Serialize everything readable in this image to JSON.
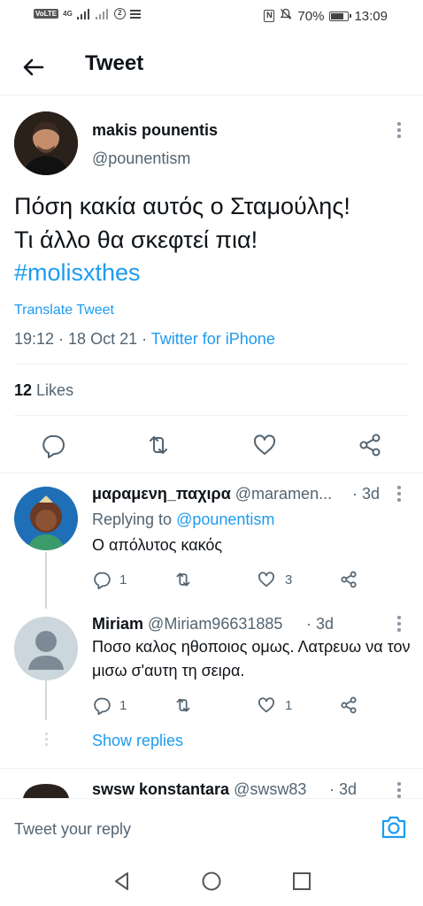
{
  "status_bar": {
    "volte": "VoLTE",
    "network": "4G",
    "battery": "70%",
    "time": "13:09"
  },
  "header": {
    "title": "Tweet"
  },
  "tweet": {
    "author_name": "makis pounentis",
    "author_handle": "@pounentism",
    "text_line1": "Πόση κακία αυτός ο Σταμούλης!",
    "text_line2": "Τι άλλο θα σκεφτεί πια!",
    "hashtag": "#molisxthes",
    "translate_label": "Translate Tweet",
    "time_date": "19:12 · 18 Oct 21 · ",
    "source": "Twitter for iPhone",
    "likes_count": "12",
    "likes_label": "Likes"
  },
  "replies": [
    {
      "name": "μαραμενη_παχιρα",
      "handle": "@maramen...",
      "time": "· 3d",
      "replying_prefix": "Replying to ",
      "replying_to": "@pounentism",
      "text": "Ο απόλυτος κακός",
      "reply_count": "1",
      "like_count": "3"
    },
    {
      "name": "Miriam",
      "handle": "@Miriam96631885",
      "time": "· 3d",
      "text": "Ποσο καλος ηθοποιος ομως. Λατρευω να τον μισω σ'αυτη τη σειρα.",
      "reply_count": "1",
      "like_count": "1"
    },
    {
      "name": "swsw konstantara",
      "handle": "@swsw83",
      "time": "· 3d"
    }
  ],
  "show_replies_label": "Show replies",
  "reply_box": {
    "placeholder": "Tweet your reply"
  },
  "colors": {
    "accent": "#1d9bf0",
    "secondary_text": "#536471",
    "primary_text": "#0f1419"
  },
  "icons": [
    "back-arrow-icon",
    "more-icon",
    "reply-icon",
    "retweet-icon",
    "like-icon",
    "share-icon",
    "camera-icon",
    "nav-back-icon",
    "nav-home-icon",
    "nav-recents-icon"
  ]
}
